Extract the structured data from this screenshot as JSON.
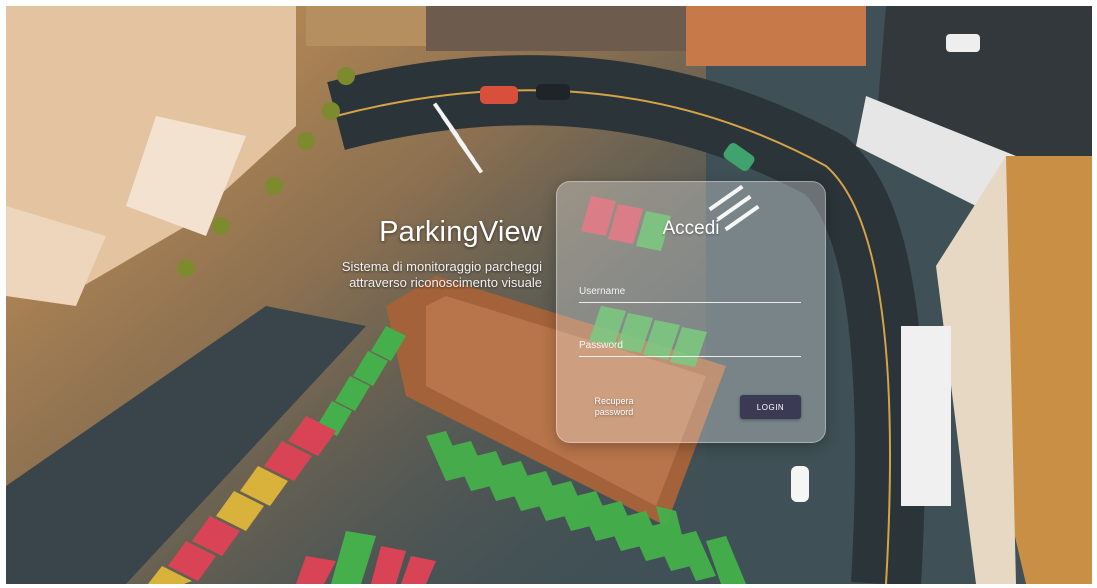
{
  "brand": {
    "title": "ParkingView",
    "subtitle_line1": "Sistema di monitoraggio parcheggi",
    "subtitle_line2": "attraverso riconoscimento visuale"
  },
  "login_card": {
    "title": "Accedi",
    "username_placeholder": "Username",
    "password_placeholder": "Password",
    "recover_line1": "Recupera",
    "recover_line2": "password",
    "login_label": "LOGIN"
  },
  "colors": {
    "login_button": "#3b3a55",
    "spot_free": "#4caf50",
    "spot_occupied": "#d84455",
    "spot_reserved": "#d8b23a"
  }
}
